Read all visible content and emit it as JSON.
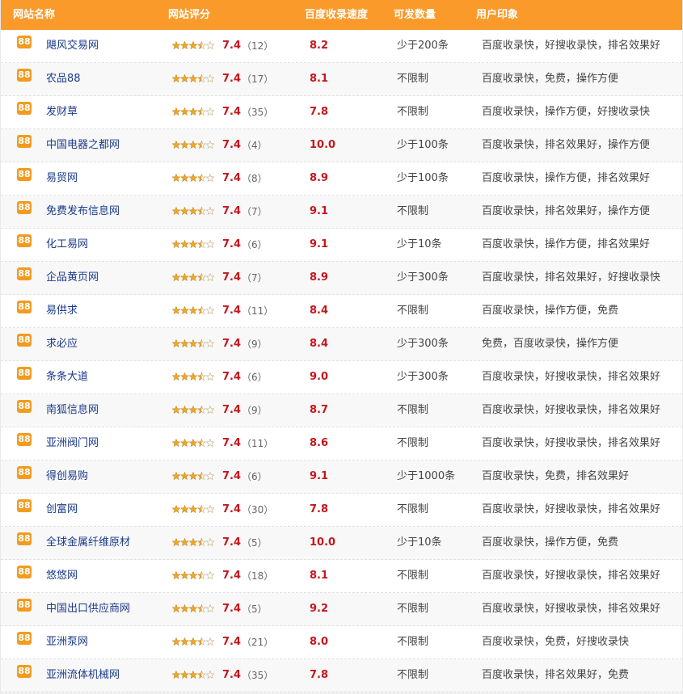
{
  "header": {
    "name": "网站名称",
    "score": "网站评分",
    "speed": "百度收录速度",
    "limit": "可发数量",
    "impression": "用户印象"
  },
  "badge_label": "88",
  "colors": {
    "header_bg": "#f99a2b",
    "badge_bg": "#f29b1f",
    "score_red": "#c4161c",
    "link_blue": "#1a3a8a",
    "star_gold": "#f0a820"
  },
  "rows": [
    {
      "name": "飓风交易网",
      "rating_stars": 3.5,
      "score": "7.4",
      "count": "（12）",
      "speed": "8.2",
      "limit": "少于200条",
      "impression": "百度收录快，好搜收录快，排名效果好"
    },
    {
      "name": "农品88",
      "rating_stars": 3.5,
      "score": "7.4",
      "count": "（17）",
      "speed": "8.1",
      "limit": "不限制",
      "impression": "百度收录快，免费，操作方便"
    },
    {
      "name": "发财草",
      "rating_stars": 3.5,
      "score": "7.4",
      "count": "（35）",
      "speed": "7.8",
      "limit": "不限制",
      "impression": "百度收录快，操作方便，好搜收录快"
    },
    {
      "name": "中国电器之都网",
      "rating_stars": 3.5,
      "score": "7.4",
      "count": "（4）",
      "speed": "10.0",
      "limit": "少于100条",
      "impression": "百度收录快，排名效果好，操作方便"
    },
    {
      "name": "易贸网",
      "rating_stars": 3.5,
      "score": "7.4",
      "count": "（8）",
      "speed": "8.9",
      "limit": "少于100条",
      "impression": "百度收录快，操作方便，排名效果好"
    },
    {
      "name": "免费发布信息网",
      "rating_stars": 3.5,
      "score": "7.4",
      "count": "（7）",
      "speed": "9.1",
      "limit": "不限制",
      "impression": "百度收录快，排名效果好，操作方便"
    },
    {
      "name": "化工易网",
      "rating_stars": 3.5,
      "score": "7.4",
      "count": "（6）",
      "speed": "9.1",
      "limit": "少于10条",
      "impression": "百度收录快，操作方便，排名效果好"
    },
    {
      "name": "企品黄页网",
      "rating_stars": 3.5,
      "score": "7.4",
      "count": "（7）",
      "speed": "8.9",
      "limit": "少于300条",
      "impression": "百度收录快，排名效果好，好搜收录快"
    },
    {
      "name": "易供求",
      "rating_stars": 3.5,
      "score": "7.4",
      "count": "（11）",
      "speed": "8.4",
      "limit": "不限制",
      "impression": "百度收录快，操作方便，免费"
    },
    {
      "name": "求必应",
      "rating_stars": 3.5,
      "score": "7.4",
      "count": "（9）",
      "speed": "8.4",
      "limit": "少于300条",
      "impression": "免费，百度收录快，操作方便"
    },
    {
      "name": "条条大道",
      "rating_stars": 3.5,
      "score": "7.4",
      "count": "（6）",
      "speed": "9.0",
      "limit": "少于300条",
      "impression": "百度收录快，好搜收录快，排名效果好"
    },
    {
      "name": "南狐信息网",
      "rating_stars": 3.5,
      "score": "7.4",
      "count": "（9）",
      "speed": "8.7",
      "limit": "不限制",
      "impression": "百度收录快，好搜收录快，排名效果好"
    },
    {
      "name": "亚洲阀门网",
      "rating_stars": 3.5,
      "score": "7.4",
      "count": "（11）",
      "speed": "8.6",
      "limit": "不限制",
      "impression": "百度收录快，好搜收录快，排名效果好"
    },
    {
      "name": "得创易购",
      "rating_stars": 3.5,
      "score": "7.4",
      "count": "（6）",
      "speed": "9.1",
      "limit": "少于1000条",
      "impression": "百度收录快，免费，排名效果好"
    },
    {
      "name": "创富网",
      "rating_stars": 3.5,
      "score": "7.4",
      "count": "（30）",
      "speed": "7.8",
      "limit": "不限制",
      "impression": "百度收录快，好搜收录快，排名效果好"
    },
    {
      "name": "全球金属纤维原材",
      "rating_stars": 3.5,
      "score": "7.4",
      "count": "（5）",
      "speed": "10.0",
      "limit": "少于10条",
      "impression": "百度收录快，操作方便，免费"
    },
    {
      "name": "悠悠网",
      "rating_stars": 3.5,
      "score": "7.4",
      "count": "（18）",
      "speed": "8.1",
      "limit": "不限制",
      "impression": "百度收录快，好搜收录快，排名效果好"
    },
    {
      "name": "中国出口供应商网",
      "rating_stars": 3.5,
      "score": "7.4",
      "count": "（5）",
      "speed": "9.2",
      "limit": "不限制",
      "impression": "百度收录快，好搜收录快，排名效果好"
    },
    {
      "name": "亚洲泵网",
      "rating_stars": 3.5,
      "score": "7.4",
      "count": "（21）",
      "speed": "8.0",
      "limit": "不限制",
      "impression": "百度收录快，免费，好搜收录快"
    },
    {
      "name": "亚洲流体机械网",
      "rating_stars": 3.5,
      "score": "7.4",
      "count": "（35）",
      "speed": "7.8",
      "limit": "不限制",
      "impression": "百度收录快，排名效果好，免费"
    }
  ]
}
